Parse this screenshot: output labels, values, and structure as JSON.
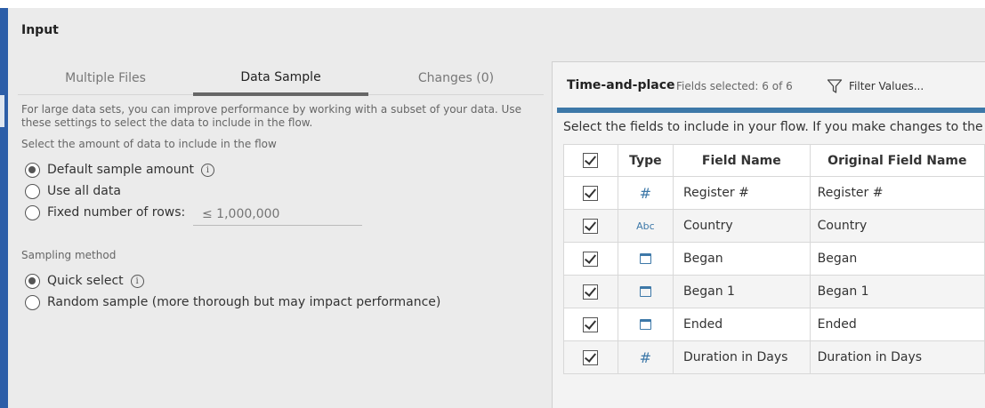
{
  "panel": {
    "title": "Input"
  },
  "tabs": [
    {
      "label": "Multiple Files"
    },
    {
      "label": "Data Sample"
    },
    {
      "label": "Changes (0)"
    }
  ],
  "sample": {
    "description": "For large data sets, you can improve performance by working with a subset of your data. Use these settings to select the data to include in the flow.",
    "amount_label": "Select the amount of data to include in the flow",
    "options": [
      {
        "label": "Default sample amount",
        "selected": true,
        "info_icon": "info-icon"
      },
      {
        "label": "Use all data",
        "selected": false
      },
      {
        "label": "Fixed number of rows:",
        "selected": false
      }
    ],
    "rows_placeholder": "≤ 1,000,000",
    "method_label": "Sampling method",
    "methods": [
      {
        "label": "Quick select",
        "selected": true,
        "info_icon": "info-icon"
      },
      {
        "label": "Random sample (more thorough but may impact performance)",
        "selected": false
      }
    ]
  },
  "right": {
    "title": "Time-and-place",
    "fields_selected": "Fields selected: 6 of 6",
    "filter_label": "Filter Values...",
    "instruction": "Select the fields to include in your flow. If you make changes to the d",
    "columns": [
      "Type",
      "Field Name",
      "Original Field Name"
    ],
    "rows": [
      {
        "checked": true,
        "type": "number",
        "type_icon": "#",
        "name": "Register #",
        "original": "Register #"
      },
      {
        "checked": true,
        "type": "string",
        "type_icon": "Abc",
        "name": "Country",
        "original": "Country"
      },
      {
        "checked": true,
        "type": "date",
        "type_icon": "calendar-icon",
        "name": "Began",
        "original": "Began"
      },
      {
        "checked": true,
        "type": "date",
        "type_icon": "calendar-icon",
        "name": "Began 1",
        "original": "Began 1"
      },
      {
        "checked": true,
        "type": "date",
        "type_icon": "calendar-icon",
        "name": "Ended",
        "original": "Ended"
      },
      {
        "checked": true,
        "type": "number",
        "type_icon": "#",
        "name": "Duration in Days",
        "original": "Duration in Days"
      }
    ]
  },
  "colors": {
    "accent": "#3d78a8",
    "rail": "#2c5ea8",
    "panel_bg": "#ebebeb"
  }
}
